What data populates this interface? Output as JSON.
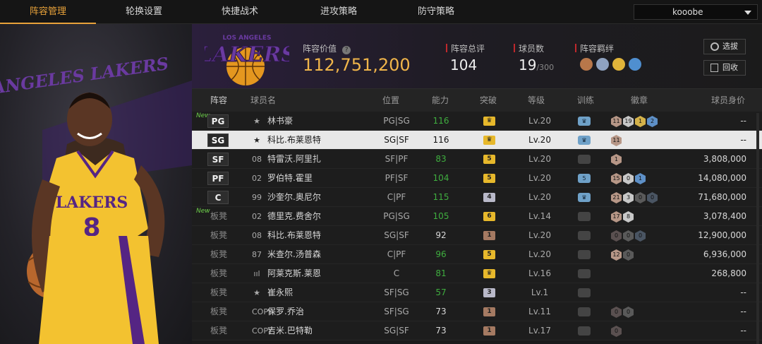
{
  "tabs": [
    "阵容管理",
    "轮换设置",
    "快捷战术",
    "进攻策略",
    "防守策略"
  ],
  "account": {
    "name": "kooobe"
  },
  "hero": {
    "team_text": "LOS ANGELES LAKERS",
    "jersey_number": "8",
    "jersey_text": "LAKERS"
  },
  "summary": {
    "logo_top": "LOS ANGELES",
    "logo_main": "LAKERS",
    "value_label": "阵容价值",
    "value": "112,751,200",
    "rating_label": "阵容总评",
    "rating": "104",
    "players_label": "球员数",
    "players": "19",
    "players_total": "/300",
    "bond_label": "阵容羁绊",
    "select_button": "选拔",
    "recycle_button": "回收"
  },
  "headers": {
    "lineup": "阵容",
    "name": "球员名",
    "position": "位置",
    "ability": "能力",
    "breakthrough": "突破",
    "level": "等级",
    "training": "训练",
    "badges": "徽章",
    "value": "球员身价"
  },
  "rows": [
    {
      "slot": "PG",
      "bench": false,
      "new": "New",
      "rank": "★",
      "name": "林书豪",
      "pos": "PG|SG",
      "ability": "116",
      "green": true,
      "brk": "♛",
      "brk_color": "#e7b82b",
      "level": "Lv.20",
      "train": "♛",
      "train_color": "#6fa1c8",
      "badges": [
        {
          "v": "11",
          "c": "#b79787"
        },
        {
          "v": "19",
          "c": "#c8c8c8"
        },
        {
          "v": "1",
          "c": "#d4b24a"
        },
        {
          "v": "2",
          "c": "#5e90c7"
        }
      ],
      "value": "--"
    },
    {
      "slot": "SG",
      "bench": false,
      "new": "",
      "rank": "★",
      "name": "科比.布莱恩特",
      "pos": "SG|SF",
      "ability": "116",
      "green": false,
      "brk": "♛",
      "brk_color": "#e7b82b",
      "level": "Lv.20",
      "train": "♛",
      "train_color": "#6fa1c8",
      "badges": [
        {
          "v": "11",
          "c": "#b79787"
        }
      ],
      "value": "--"
    },
    {
      "slot": "SF",
      "bench": false,
      "new": "",
      "rank": "08",
      "name": "特雷沃.阿里扎",
      "pos": "SF|PF",
      "ability": "83",
      "green": true,
      "brk": "5",
      "brk_color": "#e7b82b",
      "level": "Lv.20",
      "train": "",
      "train_color": "#444",
      "badges": [
        {
          "v": "1",
          "c": "#b79787"
        }
      ],
      "value": "3,808,000"
    },
    {
      "slot": "PF",
      "bench": false,
      "new": "",
      "rank": "02",
      "name": "罗伯特.霍里",
      "pos": "PF|SF",
      "ability": "104",
      "green": true,
      "brk": "5",
      "brk_color": "#e7b82b",
      "level": "Lv.20",
      "train": "5",
      "train_color": "#6fa1c8",
      "badges": [
        {
          "v": "15",
          "c": "#b79787"
        },
        {
          "v": "0",
          "c": "#c8c8c8"
        },
        {
          "v": "1",
          "c": "#5e90c7"
        }
      ],
      "value": "14,080,000"
    },
    {
      "slot": "C",
      "bench": false,
      "new": "",
      "rank": "99",
      "name": "沙奎尔.奥尼尔",
      "pos": "C|PF",
      "ability": "115",
      "green": true,
      "brk": "4",
      "brk_color": "#b9b9c9",
      "level": "Lv.20",
      "train": "♛",
      "train_color": "#6fa1c8",
      "badges": [
        {
          "v": "21",
          "c": "#b79787"
        },
        {
          "v": "3",
          "c": "#c8c8c8"
        },
        {
          "v": "0",
          "c": "#5a5a5a"
        },
        {
          "v": "0",
          "c": "#4a5563"
        }
      ],
      "value": "71,680,000"
    },
    {
      "slot": "板凳",
      "bench": true,
      "new": "New",
      "rank": "02",
      "name": "德里克.费舍尔",
      "pos": "PG|SG",
      "ability": "105",
      "green": true,
      "brk": "6",
      "brk_color": "#e7b82b",
      "level": "Lv.14",
      "train": "",
      "train_color": "#444",
      "badges": [
        {
          "v": "17",
          "c": "#b79787"
        },
        {
          "v": "8",
          "c": "#c8c8c8"
        }
      ],
      "value": "3,078,400"
    },
    {
      "slot": "板凳",
      "bench": true,
      "new": "",
      "rank": "08",
      "name": "科比.布莱恩特",
      "pos": "SG|SF",
      "ability": "92",
      "green": false,
      "brk": "1",
      "brk_color": "#a57a62",
      "level": "Lv.20",
      "train": "",
      "train_color": "#444",
      "badges": [
        {
          "v": "0",
          "c": "#5a5050"
        },
        {
          "v": "0",
          "c": "#5a5a5a"
        },
        {
          "v": "0",
          "c": "#4a5563"
        }
      ],
      "value": "12,900,000"
    },
    {
      "slot": "板凳",
      "bench": true,
      "new": "",
      "rank": "87",
      "name": "米查尔.汤普森",
      "pos": "C|PF",
      "ability": "96",
      "green": true,
      "brk": "5",
      "brk_color": "#e7b82b",
      "level": "Lv.20",
      "train": "",
      "train_color": "#444",
      "badges": [
        {
          "v": "12",
          "c": "#b79787"
        },
        {
          "v": "0",
          "c": "#5a5a5a"
        }
      ],
      "value": "6,936,000"
    },
    {
      "slot": "板凳",
      "bench": true,
      "new": "",
      "rank": "ııl",
      "name": "阿莱克斯.莱恩",
      "pos": "C",
      "ability": "81",
      "green": true,
      "brk": "♛",
      "brk_color": "#e7b82b",
      "level": "Lv.16",
      "train": "",
      "train_color": "#444",
      "badges": [],
      "value": "268,800"
    },
    {
      "slot": "板凳",
      "bench": true,
      "new": "",
      "rank": "★",
      "name": "崔永熙",
      "pos": "SF|SG",
      "ability": "57",
      "green": true,
      "brk": "3",
      "brk_color": "#b9b9c9",
      "level": "Lv.1",
      "train": "",
      "train_color": "#444",
      "badges": [],
      "value": "--"
    },
    {
      "slot": "板凳",
      "bench": true,
      "new": "",
      "rank": "COPY",
      "name": "保罗.乔治",
      "pos": "SF|SG",
      "ability": "73",
      "green": false,
      "brk": "1",
      "brk_color": "#a57a62",
      "level": "Lv.11",
      "train": "",
      "train_color": "#444",
      "badges": [
        {
          "v": "0",
          "c": "#5a5050"
        },
        {
          "v": "0",
          "c": "#5a5a5a"
        }
      ],
      "value": "--"
    },
    {
      "slot": "板凳",
      "bench": true,
      "new": "",
      "rank": "COPY",
      "name": "吉米.巴特勒",
      "pos": "SG|SF",
      "ability": "73",
      "green": false,
      "brk": "1",
      "brk_color": "#a57a62",
      "level": "Lv.17",
      "train": "",
      "train_color": "#444",
      "badges": [
        {
          "v": "0",
          "c": "#5a5050"
        }
      ],
      "value": "--"
    }
  ],
  "colors": {
    "accent": "#e8a23a",
    "value": "#f0b54a",
    "green": "#3fae3f",
    "lakers_purple": "#552583",
    "lakers_gold": "#fdb927",
    "red": "#c0282c"
  }
}
